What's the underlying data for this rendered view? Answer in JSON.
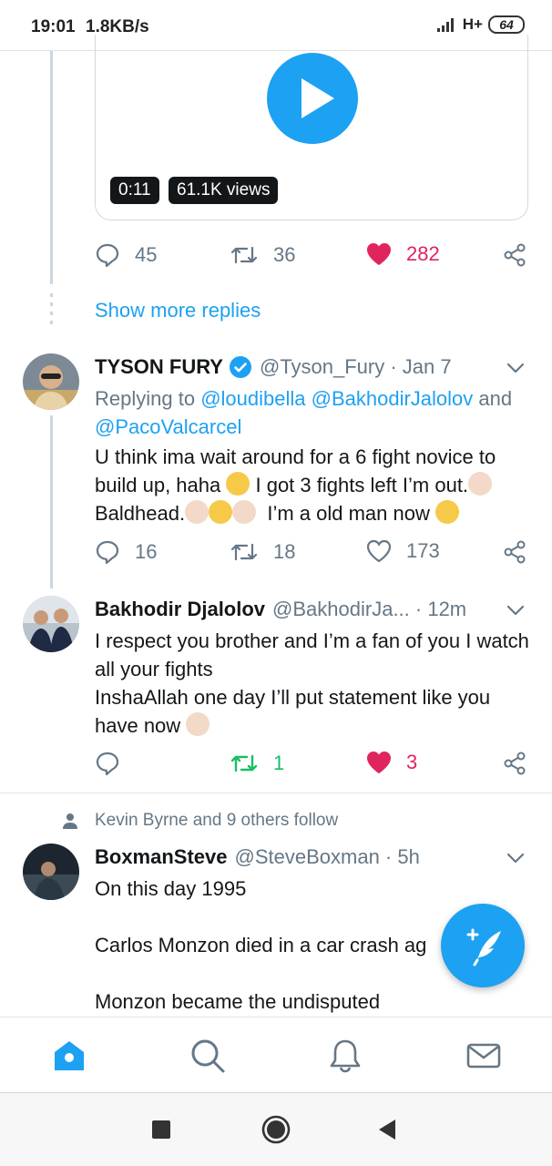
{
  "status_bar": {
    "time": "19:01",
    "speed": "1.8KB/s",
    "network": "H+",
    "battery": "64"
  },
  "video": {
    "duration": "0:11",
    "views": "61.1K views"
  },
  "tweet0_actions": {
    "replies": "45",
    "retweets": "36",
    "likes": "282"
  },
  "show_more": "Show more replies",
  "tweet1": {
    "name": "TYSON FURY",
    "handle": "@Tyson_Fury · Jan 7",
    "replying_prefix": "Replying to",
    "mention1": "@loudibella",
    "mention2": "@BakhodirJalolov",
    "and_text": "and",
    "mention3": "@PacoValcarcel",
    "text_a": "U think ima wait around for a 6 fight novice to build up, haha",
    "text_b": "I got 3 fights left I’m out.",
    "text_c": "Baldhead.",
    "text_d": "I’m a old man now",
    "replies": "16",
    "retweets": "18",
    "likes": "173"
  },
  "tweet2": {
    "name": "Bakhodir Djalolov",
    "handle": "@BakhodirJa... · 12m",
    "line1": "I respect you brother and I’m a fan of you I watch all your fights",
    "line2": "InshaAllah one day I’ll put statement like you have now",
    "retweets": "1",
    "likes": "3"
  },
  "tweet3": {
    "social_context": "Kevin Byrne and 9 others follow",
    "name": "BoxmanSteve",
    "handle": "@SteveBoxman · 5h",
    "line1": "On this day 1995",
    "line2": "Carlos Monzon died in a car crash ag",
    "line3": "Monzon became the undisputed"
  },
  "colors": {
    "accent": "#1da1f2",
    "like": "#e0245e",
    "retweet_active": "#17bf63",
    "muted": "#657786"
  },
  "icons": [
    "reply-icon",
    "retweet-icon",
    "heart-icon",
    "share-icon",
    "verified-icon",
    "chevron-down-icon",
    "home-icon",
    "search-icon",
    "bell-icon",
    "mail-icon",
    "compose-icon"
  ]
}
